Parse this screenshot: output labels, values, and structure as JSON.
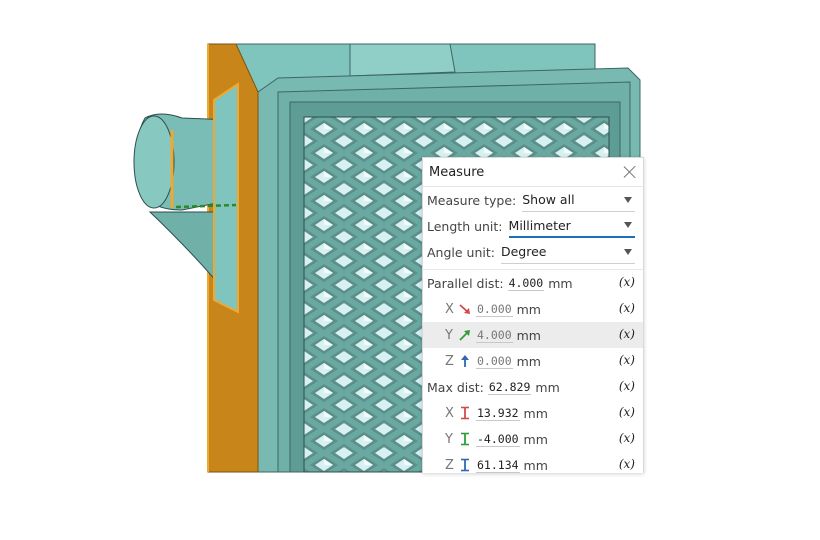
{
  "panel": {
    "title": "Measure",
    "close_icon": "close-icon",
    "measure_type": {
      "label": "Measure type:",
      "value": "Show all"
    },
    "length_unit": {
      "label": "Length unit:",
      "value": "Millimeter"
    },
    "angle_unit": {
      "label": "Angle unit:",
      "value": "Degree"
    },
    "parallel": {
      "label": "Parallel dist:",
      "value": "4.000",
      "unit": "mm",
      "x": {
        "axis": "X",
        "value": "0.000",
        "unit": "mm"
      },
      "y": {
        "axis": "Y",
        "value": "4.000",
        "unit": "mm"
      },
      "z": {
        "axis": "Z",
        "value": "0.000",
        "unit": "mm"
      }
    },
    "max": {
      "label": "Max dist:",
      "value": "62.829",
      "unit": "mm",
      "x": {
        "axis": "X",
        "value": "13.932",
        "unit": "mm"
      },
      "y": {
        "axis": "Y",
        "value": "-4.000",
        "unit": "mm"
      },
      "z": {
        "axis": "Z",
        "value": "61.134",
        "unit": "mm"
      }
    },
    "fx_label": "(x)"
  },
  "colors": {
    "accent": "#1f6fb5",
    "model_teal": "#7dbfb8",
    "selected_face": "#c8861a",
    "x_axis": "#d14b4b",
    "y_axis": "#2f9e3a",
    "z_axis": "#2f67b3"
  }
}
